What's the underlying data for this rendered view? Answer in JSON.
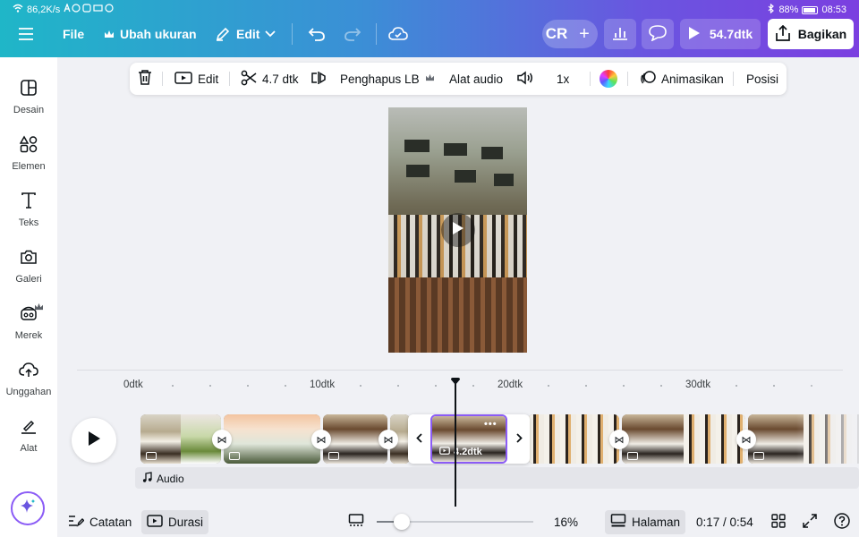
{
  "status_bar": {
    "speed": "86,2K/s",
    "battery": "88%",
    "time": "08:53"
  },
  "topbar": {
    "file": "File",
    "resize": "Ubah ukuran",
    "edit": "Edit",
    "avatar": "CR",
    "play_duration": "54.7dtk",
    "share": "Bagikan"
  },
  "sidebar": {
    "items": [
      {
        "label": "Desain",
        "icon": "design-icon"
      },
      {
        "label": "Elemen",
        "icon": "elements-icon"
      },
      {
        "label": "Teks",
        "icon": "text-icon"
      },
      {
        "label": "Galeri",
        "icon": "gallery-icon"
      },
      {
        "label": "Merek",
        "icon": "brand-icon"
      },
      {
        "label": "Unggahan",
        "icon": "upload-icon"
      },
      {
        "label": "Alat",
        "icon": "tools-icon"
      }
    ]
  },
  "context_toolbar": {
    "edit": "Edit",
    "trim": "4.7 dtk",
    "bg_remover": "Penghapus LB",
    "audio_tool": "Alat audio",
    "speed": "1x",
    "animate": "Animasikan",
    "position": "Posisi"
  },
  "timeline": {
    "ruler": [
      "0dtk",
      "10dtk",
      "20dtk",
      "30dtk"
    ],
    "selected_clip_duration": "4.2dtk",
    "audio_label": "Audio",
    "playhead_progress": 0.32
  },
  "bottom_bar": {
    "notes": "Catatan",
    "duration": "Durasi",
    "zoom": "16%",
    "zoom_fraction": 0.16,
    "pages": "Halaman",
    "time": "0:17 / 0:54"
  },
  "colors": {
    "accent": "#8b5cf6",
    "gradient_start": "#1fb6c8",
    "gradient_end": "#7b3fe0"
  }
}
